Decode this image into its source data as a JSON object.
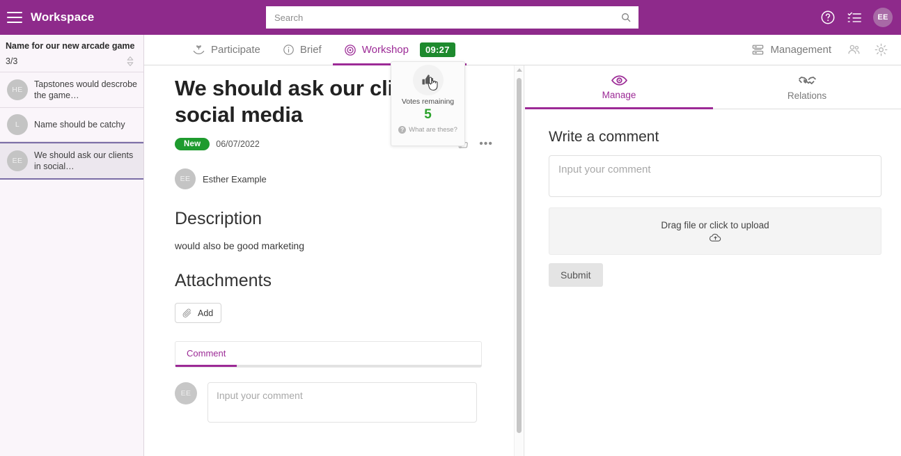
{
  "topbar": {
    "menu_icon": "hamburger-icon",
    "workspace_title": "Workspace",
    "search_placeholder": "Search",
    "search_value": "",
    "search_icon": "search-icon",
    "help_icon": "help-circle-icon",
    "tasks_icon": "checklist-icon",
    "avatar_initials": "EE",
    "brand_color": "#8e2a8b"
  },
  "sidebar": {
    "header_title": "Name for our new arcade game",
    "count": "3/3",
    "sort_icon": "sort-updown-icon",
    "items": [
      {
        "initials": "HE",
        "text": "Tapstones would descrobe the game…",
        "selected": false
      },
      {
        "initials": "L",
        "text": "Name should be catchy",
        "selected": false
      },
      {
        "initials": "EE",
        "text": "We should ask our clients in social…",
        "selected": true
      }
    ]
  },
  "subnav": {
    "tabs": [
      {
        "label": "Participate",
        "icon": "sprout-in-hand-icon",
        "active": false,
        "badge": ""
      },
      {
        "label": "Brief",
        "icon": "info-circle-icon",
        "active": false,
        "badge": ""
      },
      {
        "label": "Workshop",
        "icon": "target-icon",
        "active": true,
        "badge": "09:27"
      }
    ],
    "management_label": "Management",
    "management_icon": "server-rack-icon",
    "people_icon": "people-group-icon",
    "settings_icon": "gear-icon",
    "timer_badge_color": "#1e8a2e",
    "active_color": "#9c2a96"
  },
  "post": {
    "title": "We should ask our clients in social media",
    "badge": "New",
    "badge_color": "#1e9b2e",
    "date": "06/07/2022",
    "like_icon": "thumbs-up-icon",
    "more_icon": "ellipsis-icon",
    "author_initials": "EE",
    "author_name": "Esther Example",
    "description_heading": "Description",
    "description_body": "would also be good marketing",
    "attachments_heading": "Attachments",
    "add_label": "Add",
    "add_icon": "paperclip-icon",
    "comment_tab_label": "Comment",
    "comment_avatar": "EE",
    "comment_placeholder": "Input your comment",
    "comment_value": ""
  },
  "votes_popup": {
    "icon": "thumbs-up-icon",
    "cursor_icon": "pointer-hand-cursor",
    "label": "Votes remaining",
    "count": "5",
    "count_color": "#2aa22a",
    "help_text": "What are these?",
    "help_icon": "question-circle-icon"
  },
  "right_panel": {
    "tabs": [
      {
        "label": "Manage",
        "icon": "eye-icon",
        "active": true
      },
      {
        "label": "Relations",
        "icon": "handshake-icon",
        "active": false
      }
    ],
    "heading": "Write a comment",
    "comment_placeholder": "Input your comment",
    "comment_value": "",
    "dropzone_text": "Drag file or click to upload",
    "dropzone_icon": "cloud-upload-icon",
    "submit_label": "Submit"
  }
}
